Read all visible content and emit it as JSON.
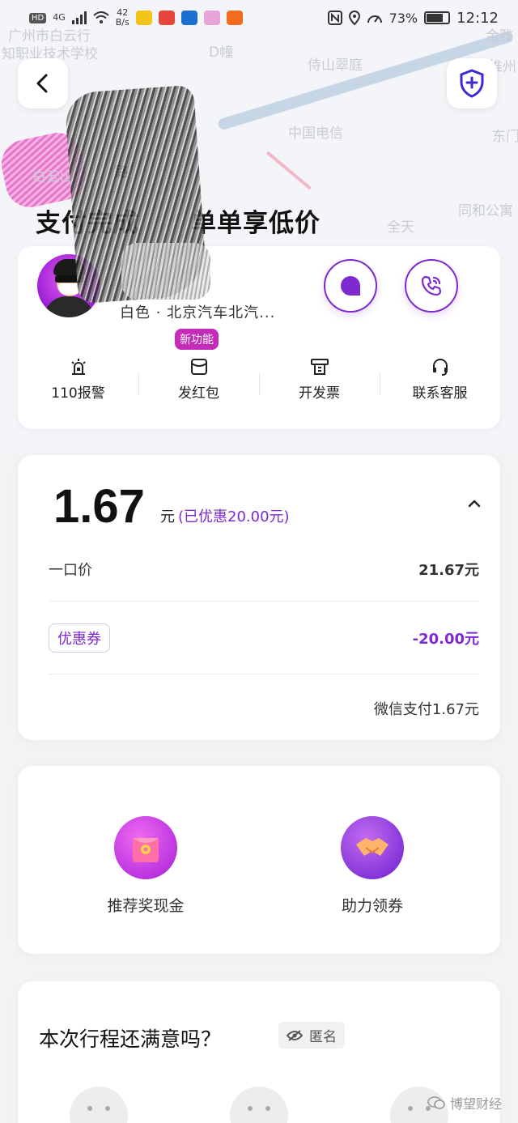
{
  "status_bar": {
    "hd": "HD",
    "network": "4G",
    "speed_value": "42",
    "speed_unit": "B/s",
    "battery": "73%",
    "time": "12:12",
    "app_colors": [
      "#f3c318",
      "#e8453c",
      "#1b6fd0",
      "#e7a4d8",
      "#f36b1c"
    ]
  },
  "map": {
    "labels": [
      "广州市白云行",
      "知职业技术学校",
      "D幢",
      "侍山翠庭",
      "中国电信",
      "全天",
      "同和公寓",
      "东门",
      "金雅",
      "推州",
      "白云山",
      "路"
    ]
  },
  "header": {
    "title": "支付完成　　单单享低价"
  },
  "driver": {
    "car_info": "白色 · 北京汽车北汽...",
    "new_badge": "新功能",
    "actions": [
      {
        "label": "110报警",
        "icon": "alarm-icon"
      },
      {
        "label": "发红包",
        "icon": "red-envelope-icon"
      },
      {
        "label": "开发票",
        "icon": "invoice-icon"
      },
      {
        "label": "联系客服",
        "icon": "customer-service-icon"
      }
    ]
  },
  "price": {
    "amount": "1.67",
    "unit": "元",
    "saved": "(已优惠20.00元)",
    "base_label": "一口价",
    "base_value": "21.67元",
    "coupon_label": "优惠券",
    "coupon_value": "-20.00元",
    "payment": "微信支付1.67元"
  },
  "rewards": [
    {
      "label": "推荐奖现金",
      "icon": "cash-gift-icon"
    },
    {
      "label": "助力领券",
      "icon": "handshake-icon"
    }
  ],
  "rating": {
    "title": "本次行程还满意吗？",
    "anonymous": "匿名"
  },
  "watermark": "博望财经",
  "colors": {
    "accent": "#7d2ad0",
    "badge": "#c42bb8"
  }
}
